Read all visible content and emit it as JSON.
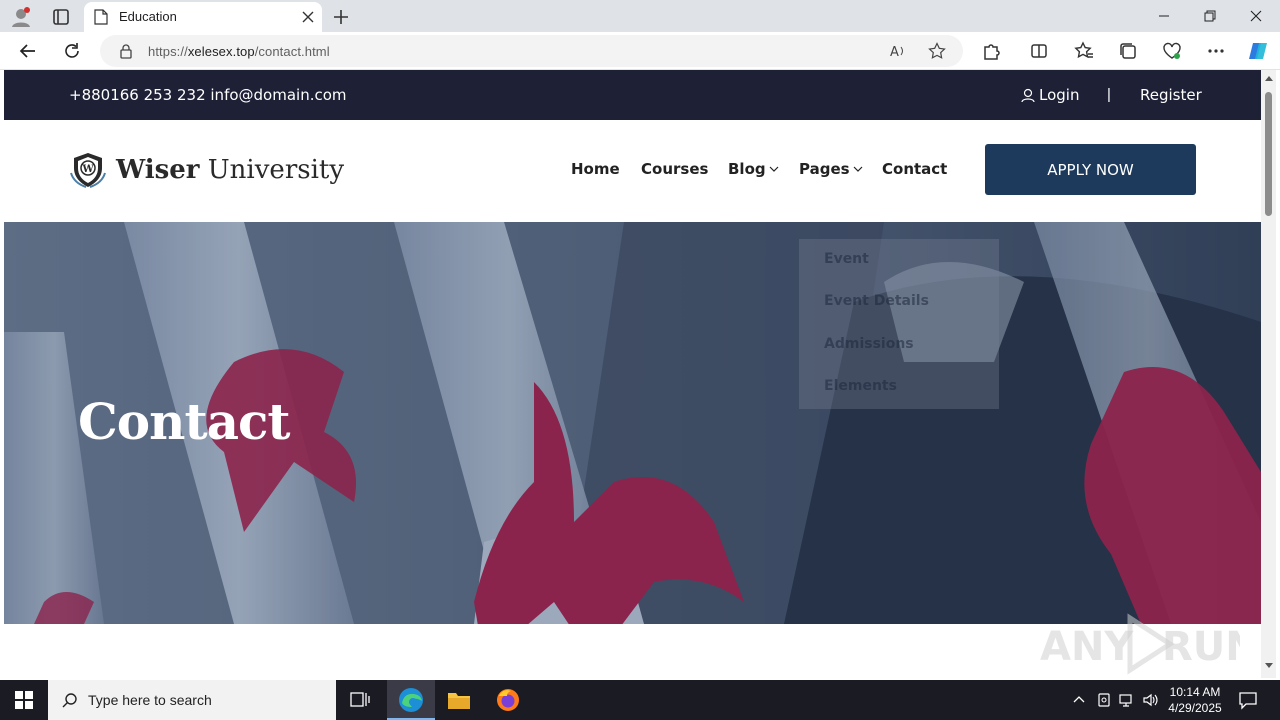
{
  "browser": {
    "tab_title": "Education",
    "url_prefix": "https://",
    "url_domain": "xelesex.top",
    "url_path": "/contact.html"
  },
  "site": {
    "topbar": {
      "contact": "+880166 253 232 info@domain.com",
      "login": "Login",
      "separator": "|",
      "register": "Register"
    },
    "logo": {
      "bold": "Wiser",
      "rest": " University"
    },
    "nav": {
      "home": "Home",
      "courses": "Courses",
      "blog": "Blog",
      "pages": "Pages",
      "contact": "Contact"
    },
    "apply_label": "APPLY NOW",
    "dropdown": [
      "Event",
      "Event Details",
      "Admissions",
      "Elements"
    ],
    "hero_title": "Contact"
  },
  "taskbar": {
    "search_placeholder": "Type here to search",
    "time": "10:14 AM",
    "date": "4/29/2025"
  },
  "watermark": "ANY RUN",
  "colors": {
    "topbar_bg": "#1e2036",
    "apply_bg": "#1d3a5c",
    "accent_ribbon": "#a3214d"
  }
}
